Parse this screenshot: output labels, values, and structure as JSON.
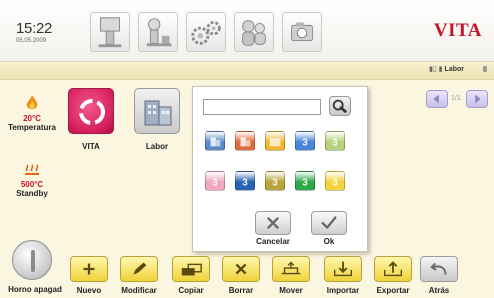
{
  "header": {
    "time": "15:22",
    "date": "05.05.2009",
    "brand": "VITA",
    "tabs": [
      {
        "name": "tab-firing",
        "icon": "furnace-icon"
      },
      {
        "name": "tab-press",
        "icon": "press-icon"
      },
      {
        "name": "tab-settings",
        "icon": "gears-icon"
      },
      {
        "name": "tab-users",
        "icon": "users-icon"
      },
      {
        "name": "tab-camera",
        "icon": "camera-icon"
      }
    ]
  },
  "subheader": {
    "program_label": "Labor"
  },
  "status": {
    "temperature_value": "20°C",
    "temperature_label": "Temperatura",
    "standby_value": "500°C",
    "standby_label": "Standby",
    "power_label": "Horno apagad"
  },
  "programs": [
    {
      "label": "VITA",
      "icon": "vita-logo-icon",
      "color": "#d81f5e"
    },
    {
      "label": "Labor",
      "icon": "building-icon",
      "color": "#cfcfcf"
    }
  ],
  "pagination": {
    "text": "1/1"
  },
  "dialog": {
    "input_value": "",
    "cancel_label": "Cancelar",
    "ok_label": "Ok",
    "icon_rows": [
      [
        {
          "color": "#5b8ac8",
          "icon": "building-blue-icon"
        },
        {
          "color": "#e06a3a",
          "icon": "building-red-icon"
        },
        {
          "color": "#f2b52c",
          "icon": "folder-orange-icon"
        },
        {
          "color": "#4a86d8",
          "icon": "number-3-blue-icon"
        },
        {
          "color": "#b7d27a",
          "icon": "number-3-green-icon"
        }
      ],
      [
        {
          "color": "#f2a7c2",
          "icon": "number-3-pink-icon"
        },
        {
          "color": "#2a63b5",
          "icon": "number-3-darkblue-icon"
        },
        {
          "color": "#b9a53a",
          "icon": "number-3-olive-icon"
        },
        {
          "color": "#2fa84a",
          "icon": "number-3-green-dark-icon"
        },
        {
          "color": "#f4d43a",
          "icon": "number-3-yellow-icon"
        }
      ]
    ]
  },
  "toolbar": {
    "items": [
      {
        "label": "Nuevo",
        "icon": "plus-icon",
        "style": "yellow"
      },
      {
        "label": "Modificar",
        "icon": "pencil-icon",
        "style": "yellow"
      },
      {
        "label": "Copiar",
        "icon": "copy-icon",
        "style": "yellow"
      },
      {
        "label": "Borrar",
        "icon": "delete-icon",
        "style": "yellow"
      },
      {
        "label": "Mover",
        "icon": "move-icon",
        "style": "yellow"
      },
      {
        "label": "Importar",
        "icon": "import-icon",
        "style": "yellow"
      },
      {
        "label": "Exportar",
        "icon": "export-icon",
        "style": "yellow"
      },
      {
        "label": "Atrás",
        "icon": "back-arrow-icon",
        "style": "gray"
      }
    ]
  }
}
